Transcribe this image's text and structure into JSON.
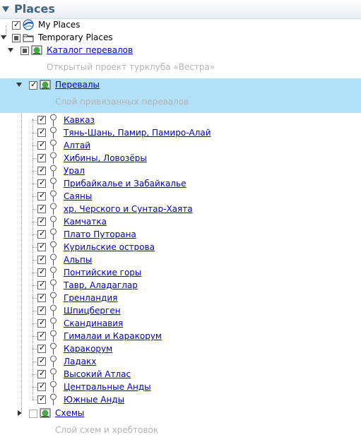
{
  "header": {
    "title": "Places"
  },
  "tree": {
    "my_places": "My Places",
    "temporary_places": "Temporary Places",
    "catalog": {
      "label": "Каталог перевалов",
      "subtitle": "Открытый проект турклуба «Вестра»"
    },
    "passes": {
      "label": "Перевалы",
      "subtitle": "Слой привязанных перевалов"
    },
    "items": [
      "Кавказ",
      "Тянь-Шань, Памир, Памиро-Алай",
      "Алтай",
      "Хибины, Ловозёры",
      "Урал",
      "Прибайкалье и Забайкалье",
      "Саяны",
      "хр. Черского и Сунтар-Хаята",
      "Камчатка",
      "Плато Путорана",
      "Курильские острова",
      "Альпы",
      "Понтийские горы",
      "Тавр, Аладаглар",
      "Гренландия",
      "Шпицберген",
      "Скандинавия",
      "Гималаи и Каракорум",
      "Каракорум",
      "Ладакх",
      "Высокий Атлас",
      "Центральные Анды",
      "Южные Анды"
    ],
    "schemes": {
      "label": "Схемы",
      "subtitle": "Слой схем и хребтовок"
    }
  },
  "colors": {
    "header_text": "#3f6486",
    "selection": "#b2e0f6",
    "link": "#0000cc",
    "subtitle": "#b4b4b4"
  }
}
